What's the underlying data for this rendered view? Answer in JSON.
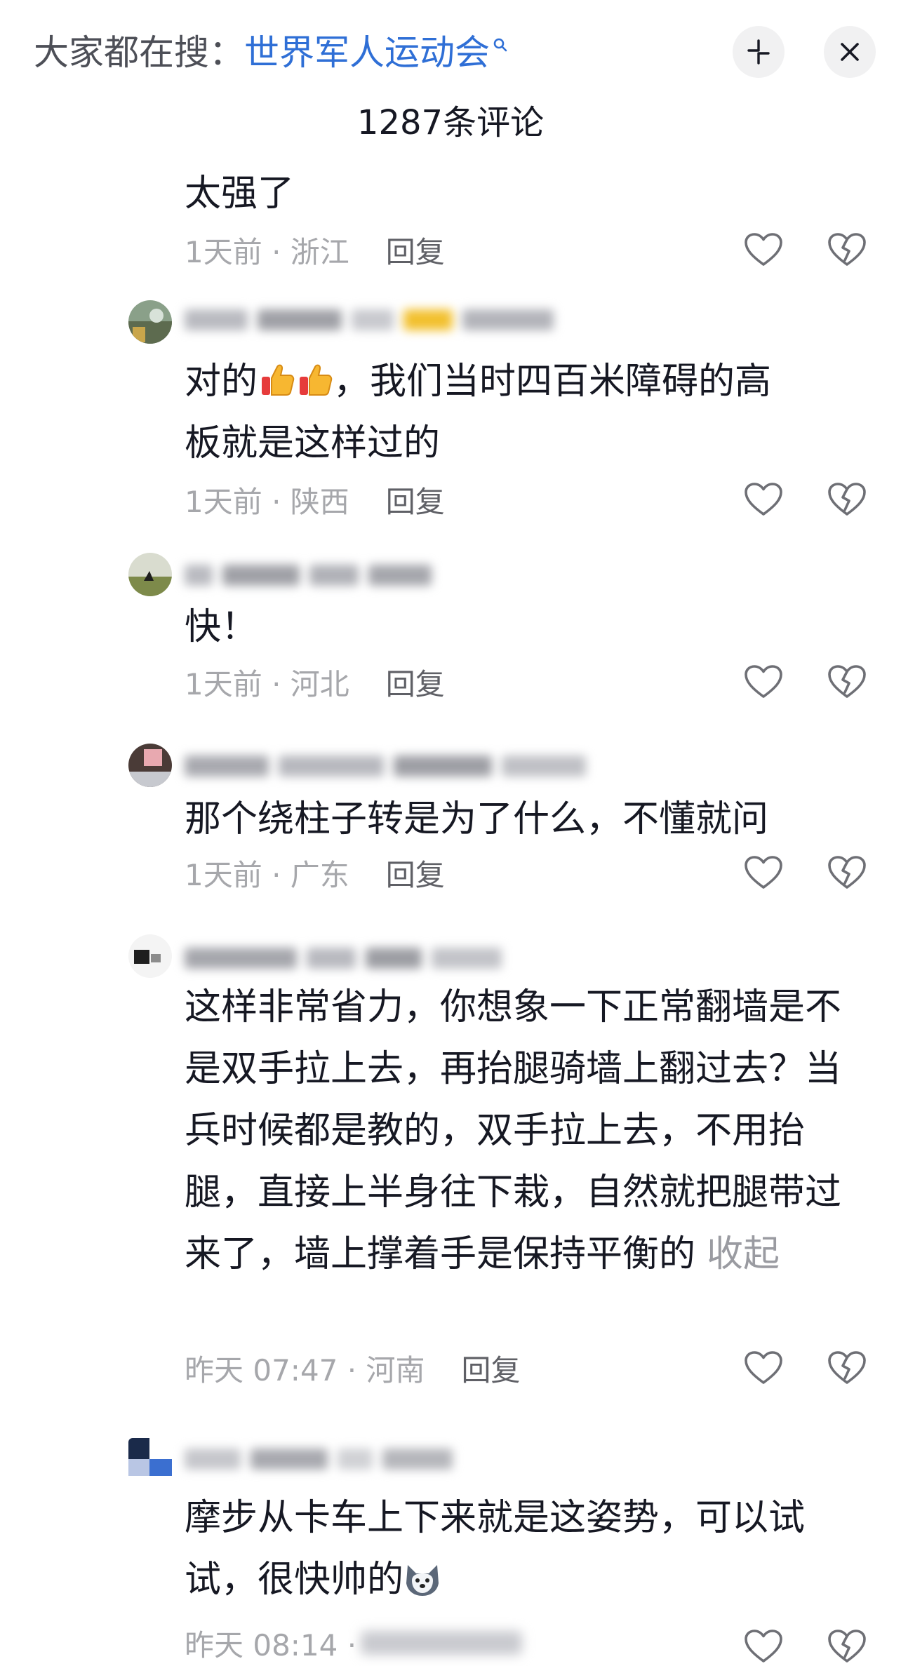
{
  "header": {
    "search_prefix": "大家都在搜：",
    "search_keyword": "世界军人运动会",
    "comment_count": "1287条评论"
  },
  "comments": [
    {
      "text": "太强了",
      "time": "1天前 · 浙江",
      "reply": "回复"
    },
    {
      "text_lines": [
        "对的",
        "，我们当时四百米障碍的高",
        "板就是这样过的"
      ],
      "emoji": "thumbs-up",
      "time": "1天前 · 陕西",
      "reply": "回复"
    },
    {
      "text": "快！",
      "time": "1天前 · 河北",
      "reply": "回复"
    },
    {
      "text": "那个绕柱子转是为了什么，不懂就问",
      "time": "1天前 · 广东",
      "reply": "回复"
    },
    {
      "text": "这样非常省力，你想象一下正常翻墙是不是双手拉上去，再抬腿骑墙上翻过去？当兵时候都是教的，双手拉上去，不用抬腿，直接上半身往下栽，自然就把腿带过来了，墙上撑着手是保持平衡的",
      "collapse": "收起",
      "time": "昨天 07:47 · 河南",
      "reply": "回复"
    },
    {
      "text": "摩步从卡车上下来就是这姿势，可以试试，很快帅的",
      "emoji": "husky-face",
      "time": "昨天 08:14 ·",
      "reply": ""
    }
  ],
  "colors": {
    "keyword_blue": "#2f6fd6",
    "meta_gray": "#a6a7ab",
    "text_dark": "#161823"
  }
}
